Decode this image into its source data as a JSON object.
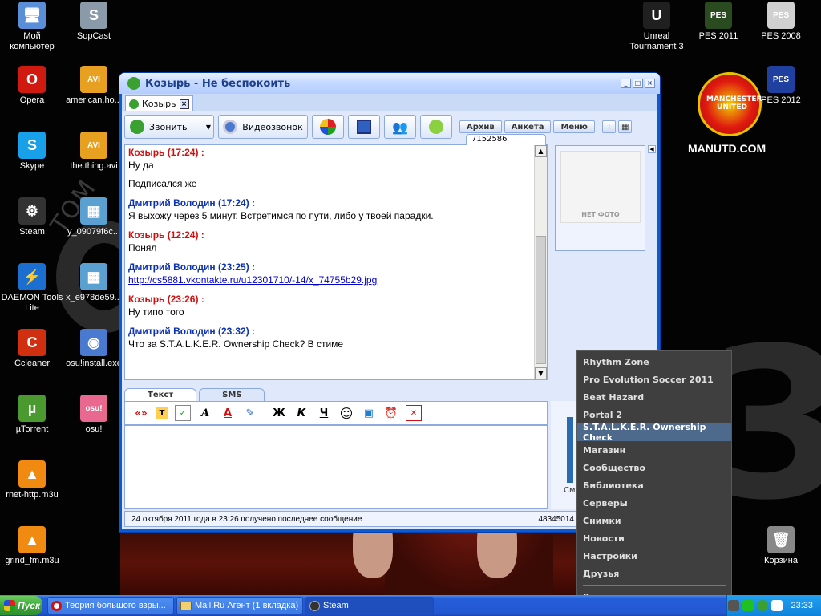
{
  "desktop": {
    "wallpaper_text": "MANUTD.COM",
    "crest_text": "MANCHESTER UNITED",
    "icons": [
      {
        "label": "Мой компьютер",
        "glyph": "🖥",
        "color": "#5a8fd8"
      },
      {
        "label": "SopCast",
        "glyph": "S",
        "color": "#8a9aa8"
      },
      {
        "label": "Opera",
        "glyph": "O",
        "color": "#d01a10"
      },
      {
        "label": "american.ho...",
        "glyph": "AVI",
        "color": "#e8a020"
      },
      {
        "label": "Skype",
        "glyph": "S",
        "color": "#18a0e8"
      },
      {
        "label": "the.thing.avi",
        "glyph": "AVI",
        "color": "#e8a020"
      },
      {
        "label": "Steam",
        "glyph": "⚙",
        "color": "#333333"
      },
      {
        "label": "y_09079f6c...",
        "glyph": "▦",
        "color": "#5aa0d0"
      },
      {
        "label": "DAEMON Tools Lite",
        "glyph": "⚡",
        "color": "#1a6fd0"
      },
      {
        "label": "x_e978de59...",
        "glyph": "▦",
        "color": "#5aa0d0"
      },
      {
        "label": "Ccleaner",
        "glyph": "C",
        "color": "#d03010"
      },
      {
        "label": "osu!install.exe",
        "glyph": "◉",
        "color": "#4a7ad0"
      },
      {
        "label": "µTorrent",
        "glyph": "µ",
        "color": "#4a9a30"
      },
      {
        "label": "osu!",
        "glyph": "osu!",
        "color": "#e86890"
      },
      {
        "label": "rnet-http.m3u",
        "glyph": "▲",
        "color": "#f08a10"
      },
      {
        "label": "grind_fm.m3u",
        "glyph": "▲",
        "color": "#f08a10"
      },
      {
        "label": "Unreal Tournament 3",
        "glyph": "U",
        "color": "#202020"
      },
      {
        "label": "PES 2011",
        "glyph": "PES",
        "color": "#2a4a20"
      },
      {
        "label": "PES 2008",
        "glyph": "PES",
        "color": "#d0d0d0"
      },
      {
        "label": "PES 2012",
        "glyph": "PES",
        "color": "#2040a0"
      },
      {
        "label": "Корзина",
        "glyph": "🗑",
        "color": "#888888"
      }
    ]
  },
  "window": {
    "title": "Козырь - Не беспокоить",
    "tab_label": "Козырь",
    "toolbar": {
      "call": "Звонить",
      "video": "Видеозвонок",
      "archive": "Архив",
      "profile": "Анкета",
      "menu": "Меню"
    },
    "contact_id": "7152586",
    "photo_placeholder": "НЕТ ФОТО",
    "messages": [
      {
        "from": "Козырь (17:24) :",
        "type": "k",
        "lines": [
          "Ну да",
          "Подписался же"
        ]
      },
      {
        "from": "Дмитрий Володин (17:24) :",
        "type": "d",
        "lines": [
          "Я выхожу через 5 минут. Встретимся по пути, либо у твоей парадки."
        ]
      },
      {
        "from": "Козырь (12:24) :",
        "type": "k",
        "lines": [
          "Понял"
        ]
      },
      {
        "from": "Дмитрий Володин (23:25) :",
        "type": "d",
        "link": "http://cs5881.vkontakte.ru/u12301710/-14/x_74755b29.jpg"
      },
      {
        "from": "Козырь (23:26) :",
        "type": "k",
        "lines": [
          "Ну типо того"
        ]
      },
      {
        "from": "Дмитрий Володин (23:32) :",
        "type": "d",
        "lines": [
          "Что за S.T.A.L.K.E.R. Ownership Check? В стиме"
        ]
      }
    ],
    "input_tabs": [
      "Текст",
      "SMS"
    ],
    "status_text": "24 октября 2011 года в 23:26 получено последнее сообщение",
    "status_number": "48345014",
    "right_link": "См"
  },
  "context_menu": {
    "items_top": [
      "Rhythm Zone",
      "Pro Evolution Soccer 2011",
      "Beat Hazard",
      "Portal 2",
      "S.T.A.L.K.E.R. Ownership Check"
    ],
    "items_mid": [
      "Магазин",
      "Сообщество",
      "Библиотека",
      "Серверы",
      "Снимки",
      "Новости",
      "Настройки",
      "Друзья"
    ],
    "items_bottom": [
      "Выход"
    ]
  },
  "taskbar": {
    "start": "Пуск",
    "tasks": [
      "Теория большого взры...",
      "Mail.Ru Агент (1 вкладка)",
      "Steam"
    ],
    "clock": "23:33"
  }
}
